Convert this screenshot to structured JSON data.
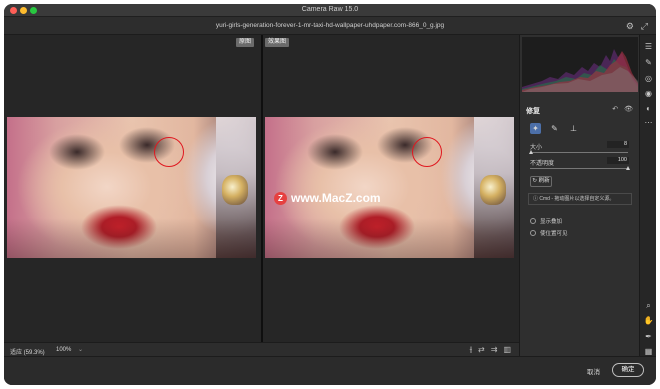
{
  "window": {
    "title": "Camera Raw 15.0",
    "filename": "yuri-girls-generation-forever-1-mr-taxi-hd-wallpaper-uhdpaper.com-866_0_g.jpg"
  },
  "canvas": {
    "before_label": "原图",
    "after_label": "效果图",
    "watermark": "www.MacZ.com",
    "watermark_logo": "Z"
  },
  "bottombar": {
    "zoom_fit": "适应 (59.3%)",
    "zoom_100": "100%",
    "zoom_chevron": "⌄",
    "view_icons": [
      "split-icon",
      "swap-icon",
      "copy-icon",
      "layout-icon"
    ]
  },
  "panel": {
    "title": "修复",
    "undo_icon": "↶",
    "eye_icon": "👁",
    "size_label": "大小",
    "size_value": "8",
    "size_level": 0.02,
    "opacity_label": "不透明度",
    "opacity_value": "100",
    "opacity_level": 1.0,
    "refresh_label": "刷新",
    "info_text": "Cmd - 拖动图片以选择自定义源。",
    "overlay_label": "显示叠加",
    "visualize_label": "使位置可见"
  },
  "footer": {
    "cancel_label": "取消",
    "ok_label": "确定"
  },
  "colors": {
    "accent": "#4c6fa8",
    "circle": "#e0171f",
    "traffic_red": "#ff5f57",
    "traffic_yellow": "#febc2e",
    "traffic_green": "#28c840"
  }
}
